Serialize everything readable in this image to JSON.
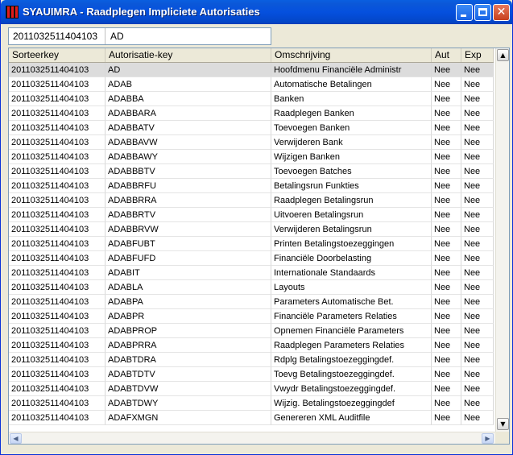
{
  "window": {
    "title": "SYAUIMRA - Raadplegen Impliciete Autorisaties",
    "accent": "#0550de",
    "close_color": "#c7401e",
    "minimize_icon": "minimize-icon",
    "maximize_icon": "maximize-icon",
    "close_icon": "close-icon",
    "close_glyph": "✕"
  },
  "filter": {
    "key": "2011032511404103",
    "value": "AD"
  },
  "table": {
    "columns": [
      "Sorteerkey",
      "Autorisatie-key",
      "Omschrijving",
      "Aut",
      "Exp"
    ],
    "selected_row": 0,
    "rows": [
      [
        "2011032511404103",
        "AD",
        "Hoofdmenu Financiële Administr",
        "Nee",
        "Nee"
      ],
      [
        "2011032511404103",
        "ADAB",
        "Automatische Betalingen",
        "Nee",
        "Nee"
      ],
      [
        "2011032511404103",
        "ADABBA",
        "Banken",
        "Nee",
        "Nee"
      ],
      [
        "2011032511404103",
        "ADABBARA",
        "Raadplegen Banken",
        "Nee",
        "Nee"
      ],
      [
        "2011032511404103",
        "ADABBATV",
        "Toevoegen Banken",
        "Nee",
        "Nee"
      ],
      [
        "2011032511404103",
        "ADABBAVW",
        "Verwijderen Bank",
        "Nee",
        "Nee"
      ],
      [
        "2011032511404103",
        "ADABBAWY",
        "Wijzigen Banken",
        "Nee",
        "Nee"
      ],
      [
        "2011032511404103",
        "ADABBBTV",
        "Toevoegen Batches",
        "Nee",
        "Nee"
      ],
      [
        "2011032511404103",
        "ADABBRFU",
        "Betalingsrun Funkties",
        "Nee",
        "Nee"
      ],
      [
        "2011032511404103",
        "ADABBRRA",
        "Raadplegen Betalingsrun",
        "Nee",
        "Nee"
      ],
      [
        "2011032511404103",
        "ADABBRTV",
        "Uitvoeren Betalingsrun",
        "Nee",
        "Nee"
      ],
      [
        "2011032511404103",
        "ADABBRVW",
        "Verwijderen Betalingsrun",
        "Nee",
        "Nee"
      ],
      [
        "2011032511404103",
        "ADABFUBT",
        "Printen Betalingstoezeggingen",
        "Nee",
        "Nee"
      ],
      [
        "2011032511404103",
        "ADABFUFD",
        "Financiële Doorbelasting",
        "Nee",
        "Nee"
      ],
      [
        "2011032511404103",
        "ADABIT",
        "Internationale Standaards",
        "Nee",
        "Nee"
      ],
      [
        "2011032511404103",
        "ADABLA",
        "Layouts",
        "Nee",
        "Nee"
      ],
      [
        "2011032511404103",
        "ADABPA",
        "Parameters Automatische Bet.",
        "Nee",
        "Nee"
      ],
      [
        "2011032511404103",
        "ADABPR",
        "Financiële Parameters Relaties",
        "Nee",
        "Nee"
      ],
      [
        "2011032511404103",
        "ADABPROP",
        "Opnemen Financiële Parameters",
        "Nee",
        "Nee"
      ],
      [
        "2011032511404103",
        "ADABPRRA",
        "Raadplegen Parameters Relaties",
        "Nee",
        "Nee"
      ],
      [
        "2011032511404103",
        "ADABTDRA",
        "Rdplg Betalingstoezeggingdef.",
        "Nee",
        "Nee"
      ],
      [
        "2011032511404103",
        "ADABTDTV",
        "Toevg Betalingstoezeggingdef.",
        "Nee",
        "Nee"
      ],
      [
        "2011032511404103",
        "ADABTDVW",
        "Vwydr Betalingstoezeggingdef.",
        "Nee",
        "Nee"
      ],
      [
        "2011032511404103",
        "ADABTDWY",
        "Wijzig. Betalingstoezeggingdef",
        "Nee",
        "Nee"
      ],
      [
        "2011032511404103",
        "ADAFXMGN",
        "Genereren XML Auditfile",
        "Nee",
        "Nee"
      ]
    ]
  },
  "scrollbars": {
    "up_icon": "scroll-up-icon",
    "down_icon": "scroll-down-icon",
    "left_icon": "scroll-left-icon",
    "right_icon": "scroll-right-icon",
    "up_glyph": "▲",
    "down_glyph": "▼",
    "left_glyph": "◀",
    "right_glyph": "▶"
  }
}
